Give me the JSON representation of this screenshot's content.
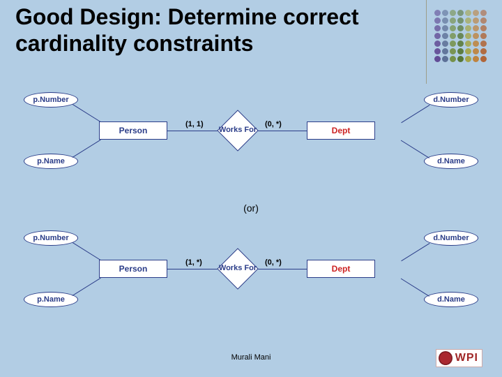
{
  "title": "Good Design: Determine correct cardinality constraints",
  "or_label": "(or)",
  "author": "Murali Mani",
  "logo_text": "WPI",
  "dot_colors": [
    "#5a3f8e",
    "#54668f",
    "#6f8a3a",
    "#4e6e24",
    "#a3a13a",
    "#c07b2e",
    "#b05a26"
  ],
  "diagrams": [
    {
      "left_entity": "Person",
      "right_entity": "Dept",
      "relationship": "Works For",
      "left_card": "(1, 1)",
      "right_card": "(0, *)",
      "left_attrs": [
        "p.Number",
        "p.Name"
      ],
      "right_attrs": [
        "d.Number",
        "d.Name"
      ]
    },
    {
      "left_entity": "Person",
      "right_entity": "Dept",
      "relationship": "Works For",
      "left_card": "(1, *)",
      "right_card": "(0, *)",
      "left_attrs": [
        "p.Number",
        "p.Name"
      ],
      "right_attrs": [
        "d.Number",
        "d.Name"
      ]
    }
  ]
}
